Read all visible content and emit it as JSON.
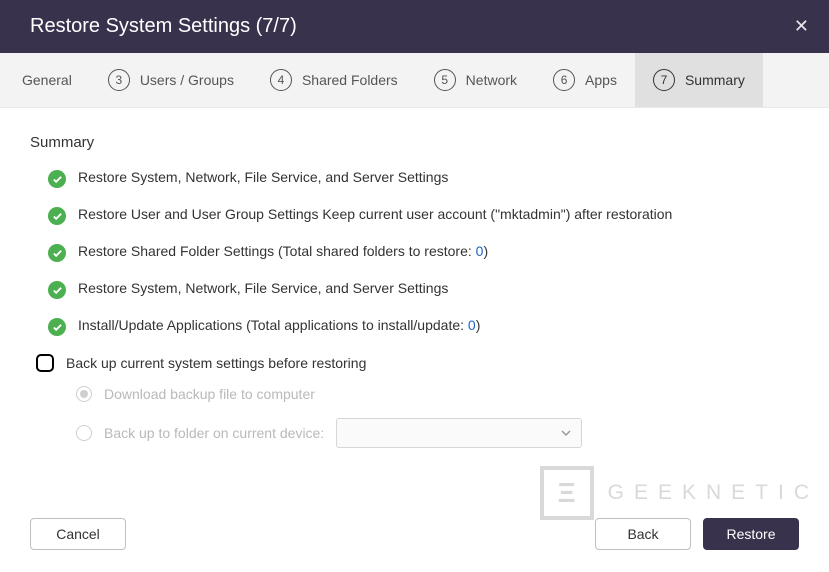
{
  "header": {
    "title": "Restore System Settings (7/7)"
  },
  "steps": [
    {
      "num": "",
      "label": "General"
    },
    {
      "num": "3",
      "label": "Users / Groups"
    },
    {
      "num": "4",
      "label": "Shared Folders"
    },
    {
      "num": "5",
      "label": "Network"
    },
    {
      "num": "6",
      "label": "Apps"
    },
    {
      "num": "7",
      "label": "Summary"
    }
  ],
  "section_title": "Summary",
  "summary": [
    {
      "text": "Restore System, Network, File Service, and Server Settings"
    },
    {
      "text": "Restore User and User Group Settings Keep current user account (\"mktadmin\") after restoration"
    },
    {
      "prefix": "Restore Shared Folder Settings (Total shared folders to restore: ",
      "num": "0",
      "suffix": ")"
    },
    {
      "text": "Restore System, Network, File Service, and Server Settings"
    },
    {
      "prefix": "Install/Update Applications (Total applications to install/update: ",
      "num": "0",
      "suffix": ")"
    }
  ],
  "backup_checkbox_label": "Back up current system settings before restoring",
  "sub_options": {
    "download_label": "Download backup file to computer",
    "folder_label": "Back up to folder on current device:"
  },
  "buttons": {
    "cancel": "Cancel",
    "back": "Back",
    "restore": "Restore"
  },
  "watermark": {
    "logo": "Ξ",
    "text": "GEEKNETIC"
  }
}
